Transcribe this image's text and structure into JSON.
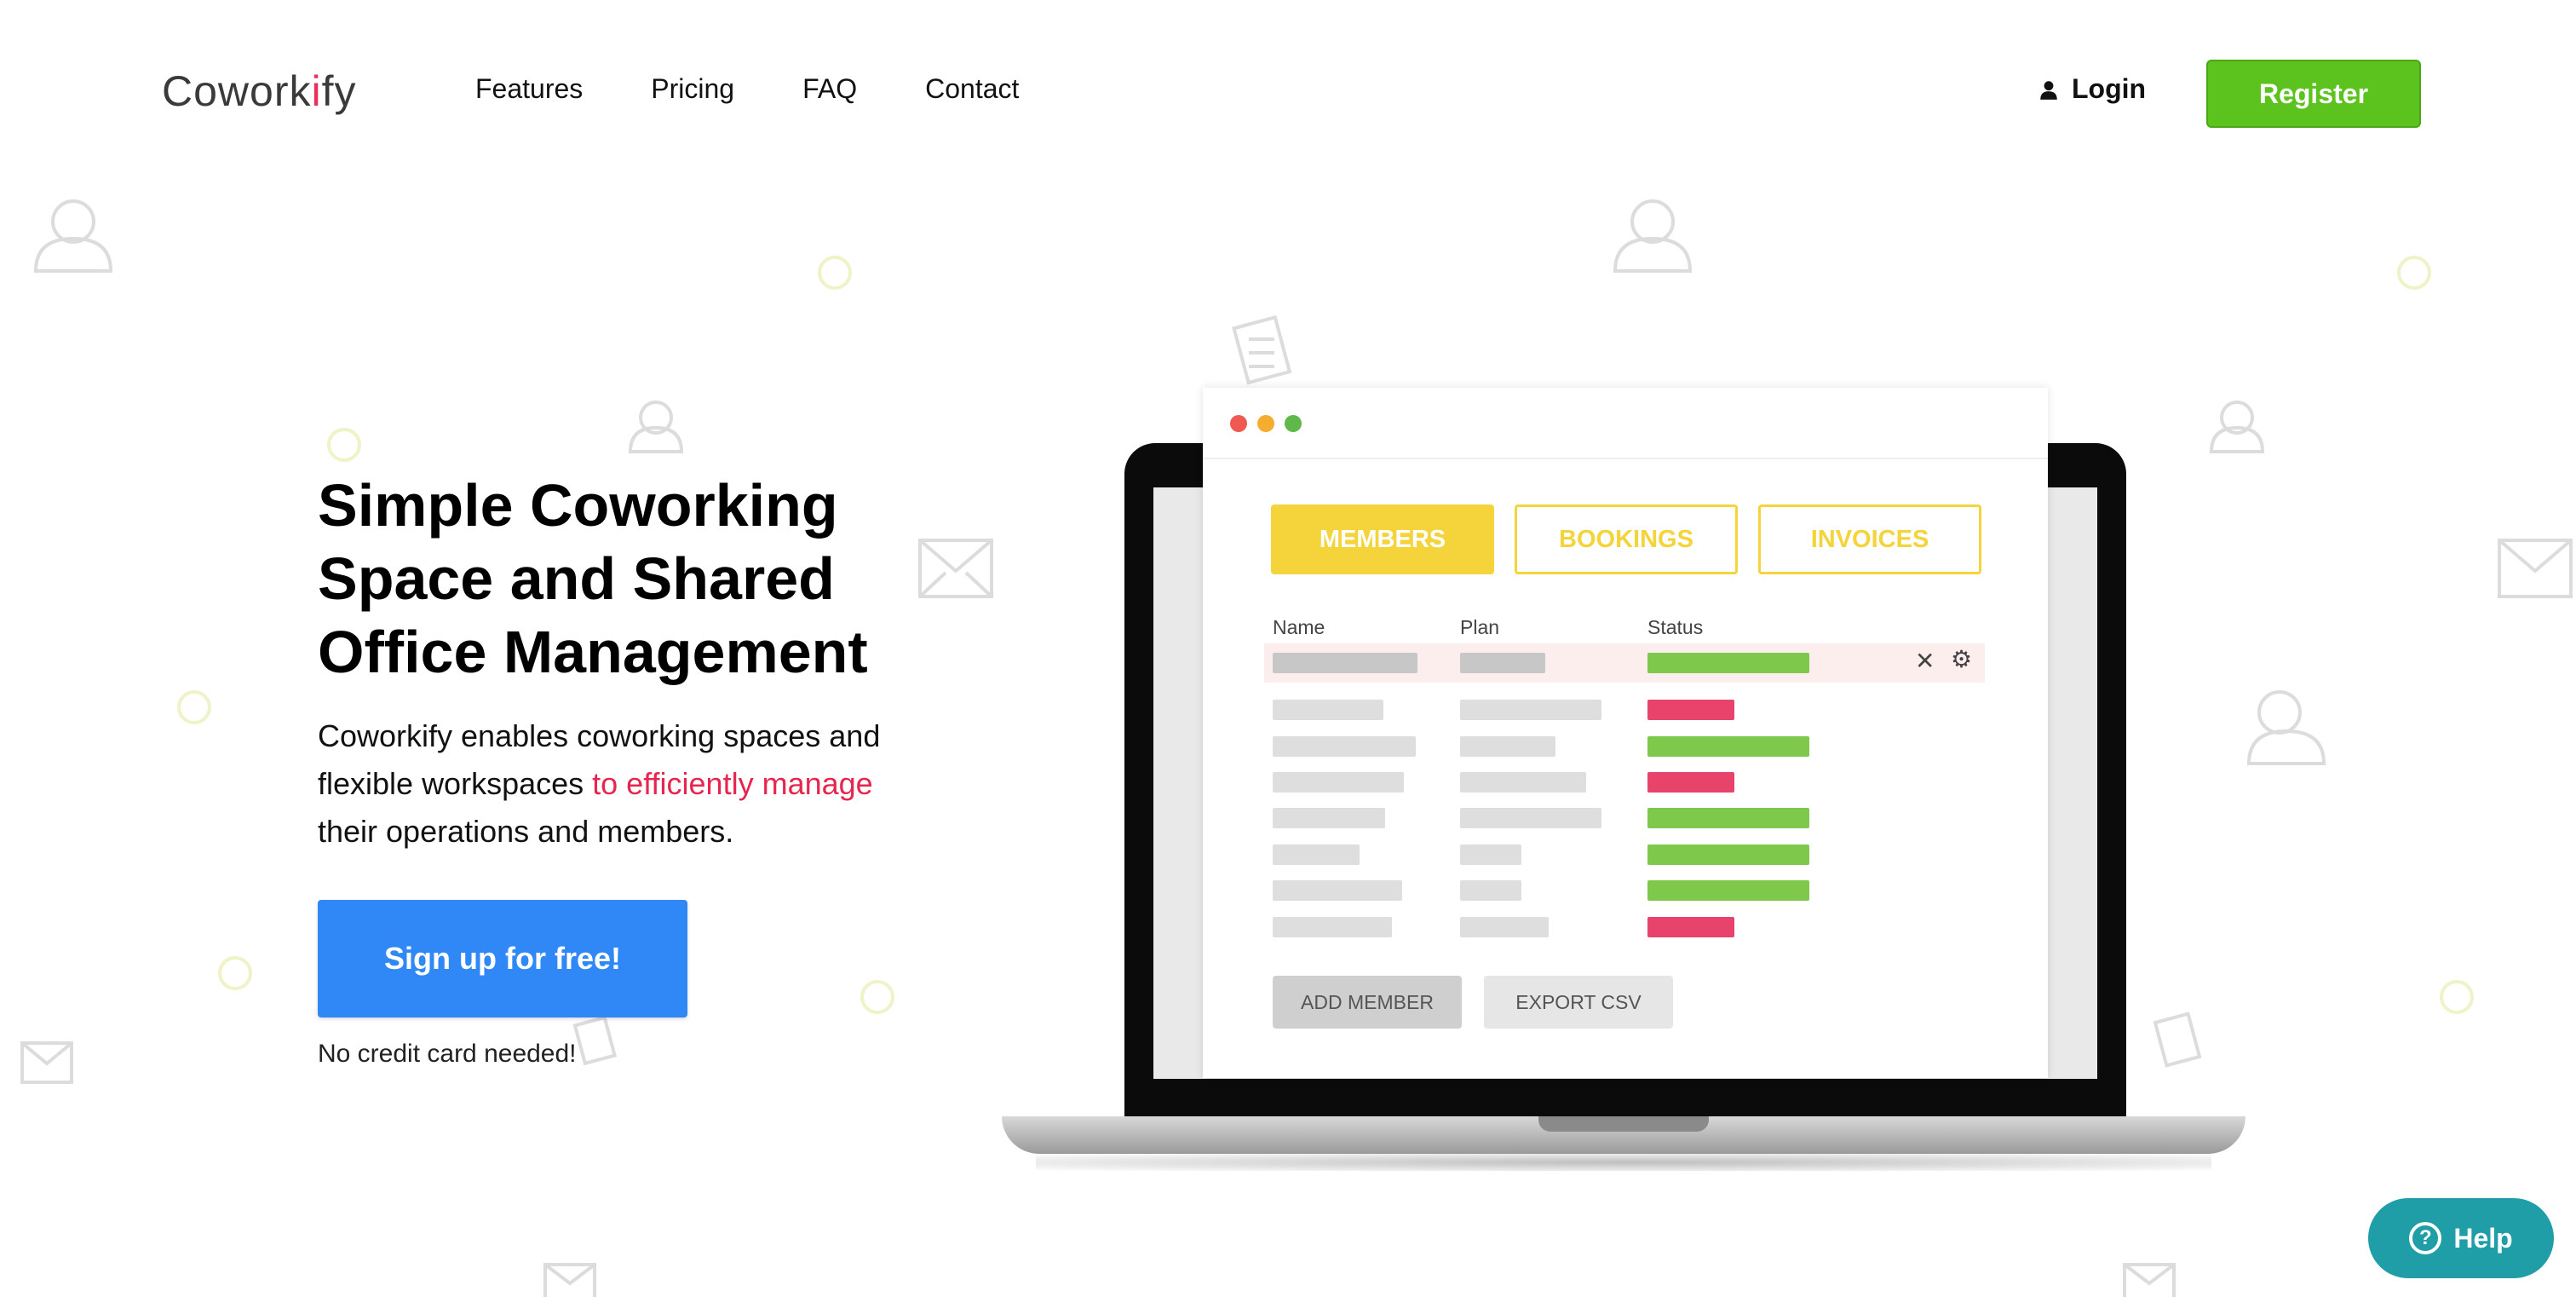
{
  "brand": {
    "name_prefix": "Cowork",
    "name_dot": "i",
    "name_suffix": "fy"
  },
  "nav": {
    "items": [
      "Features",
      "Pricing",
      "FAQ",
      "Contact"
    ]
  },
  "header": {
    "login_label": "Login",
    "register_label": "Register"
  },
  "hero": {
    "title_line1": "Simple Coworking",
    "title_line2": "Space and Shared",
    "title_line3": "Office Management",
    "text_part1": "Coworkify enables coworking spaces and flexible workspaces ",
    "text_highlight": "to efficiently manage",
    "text_part2": " their operations and members.",
    "cta_label": "Sign up for free!",
    "cta_note": "No credit card needed!"
  },
  "mockup": {
    "tabs": [
      "MEMBERS",
      "BOOKINGS",
      "INVOICES"
    ],
    "columns": [
      "Name",
      "Plan",
      "Status"
    ],
    "actions": [
      "ADD MEMBER",
      "EXPORT CSV"
    ],
    "row_statuses": [
      "active",
      "inactive",
      "active",
      "inactive",
      "active",
      "active",
      "active",
      "inactive"
    ],
    "colors": {
      "accent": "#f4d43a",
      "active": "#7ec94c",
      "inactive": "#e8436a"
    }
  },
  "help": {
    "label": "Help"
  },
  "colors": {
    "register": "#5cc31e",
    "signup": "#2f88f5",
    "highlight": "#e6264f",
    "help": "#1f9ea7"
  }
}
